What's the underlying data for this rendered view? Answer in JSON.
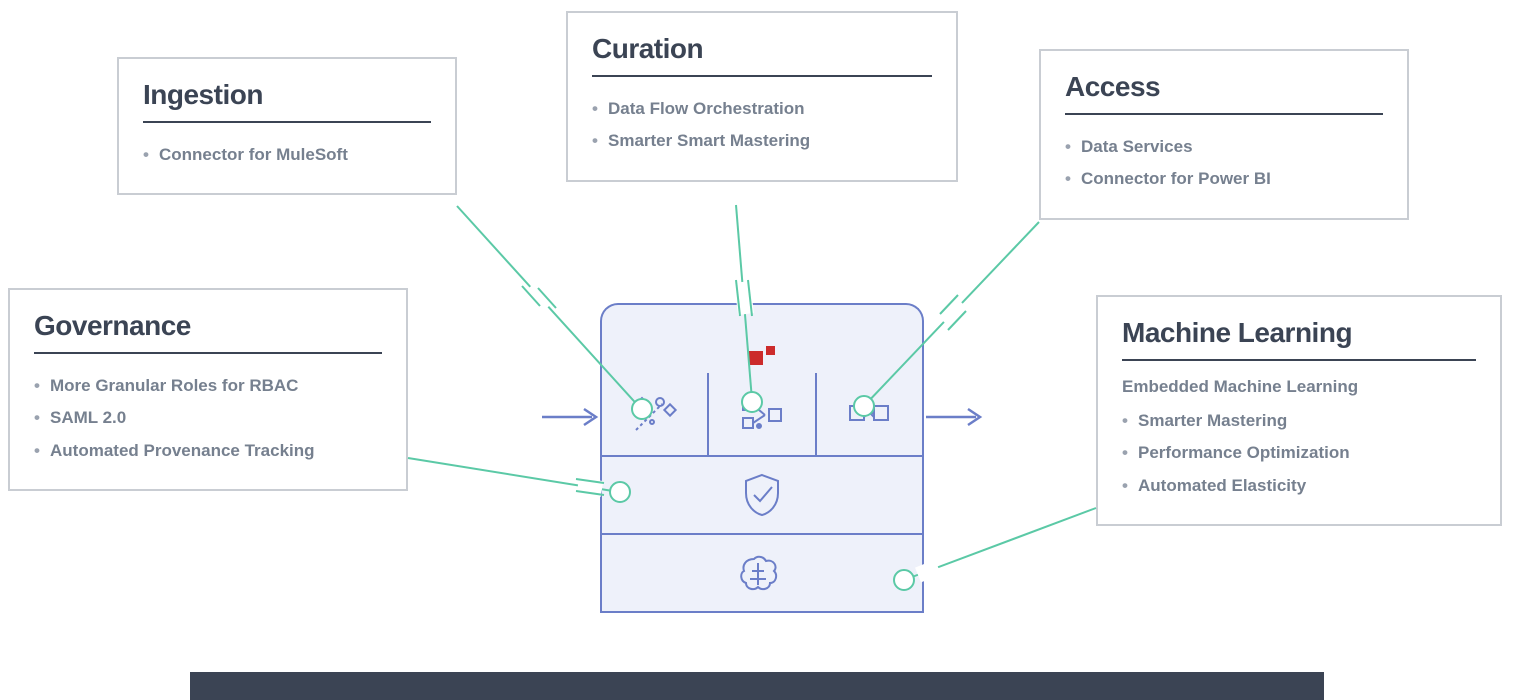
{
  "cards": {
    "ingestion": {
      "title": "Ingestion",
      "items": [
        "Connector for MuleSoft"
      ]
    },
    "curation": {
      "title": "Curation",
      "items": [
        "Data Flow Orchestration",
        "Smarter Smart Mastering"
      ]
    },
    "access": {
      "title": "Access",
      "items": [
        "Data Services",
        "Connector for Power BI"
      ]
    },
    "governance": {
      "title": "Governance",
      "items": [
        "More Granular Roles for RBAC",
        "SAML 2.0",
        "Automated Provenance Tracking"
      ]
    },
    "machine_learning": {
      "title": "Machine Learning",
      "subtitle": "Embedded Machine Learning",
      "items": [
        "Smarter Mastering",
        "Performance Optimization",
        "Automated Elasticity"
      ]
    }
  }
}
